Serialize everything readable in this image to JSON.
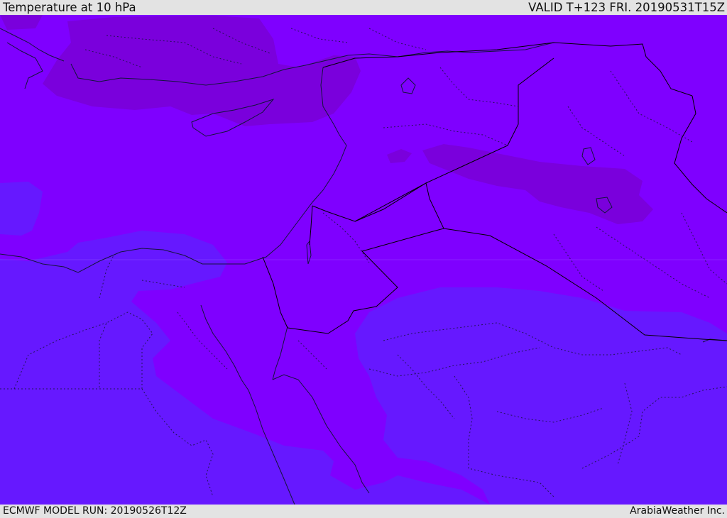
{
  "header": {
    "title": "Temperature at 10 hPa",
    "valid": "VALID T+123 FRI. 20190531T15Z"
  },
  "footer": {
    "model_run": "ECMWF MODEL RUN: 20190526T12Z",
    "credit": "ArabiaWeather Inc."
  },
  "colors": {
    "band_violet": "#7f00ff",
    "band_purple": "#7a00dc",
    "band_indigo": "#6618ff",
    "coastline": "#14143c",
    "border": "#000000"
  }
}
